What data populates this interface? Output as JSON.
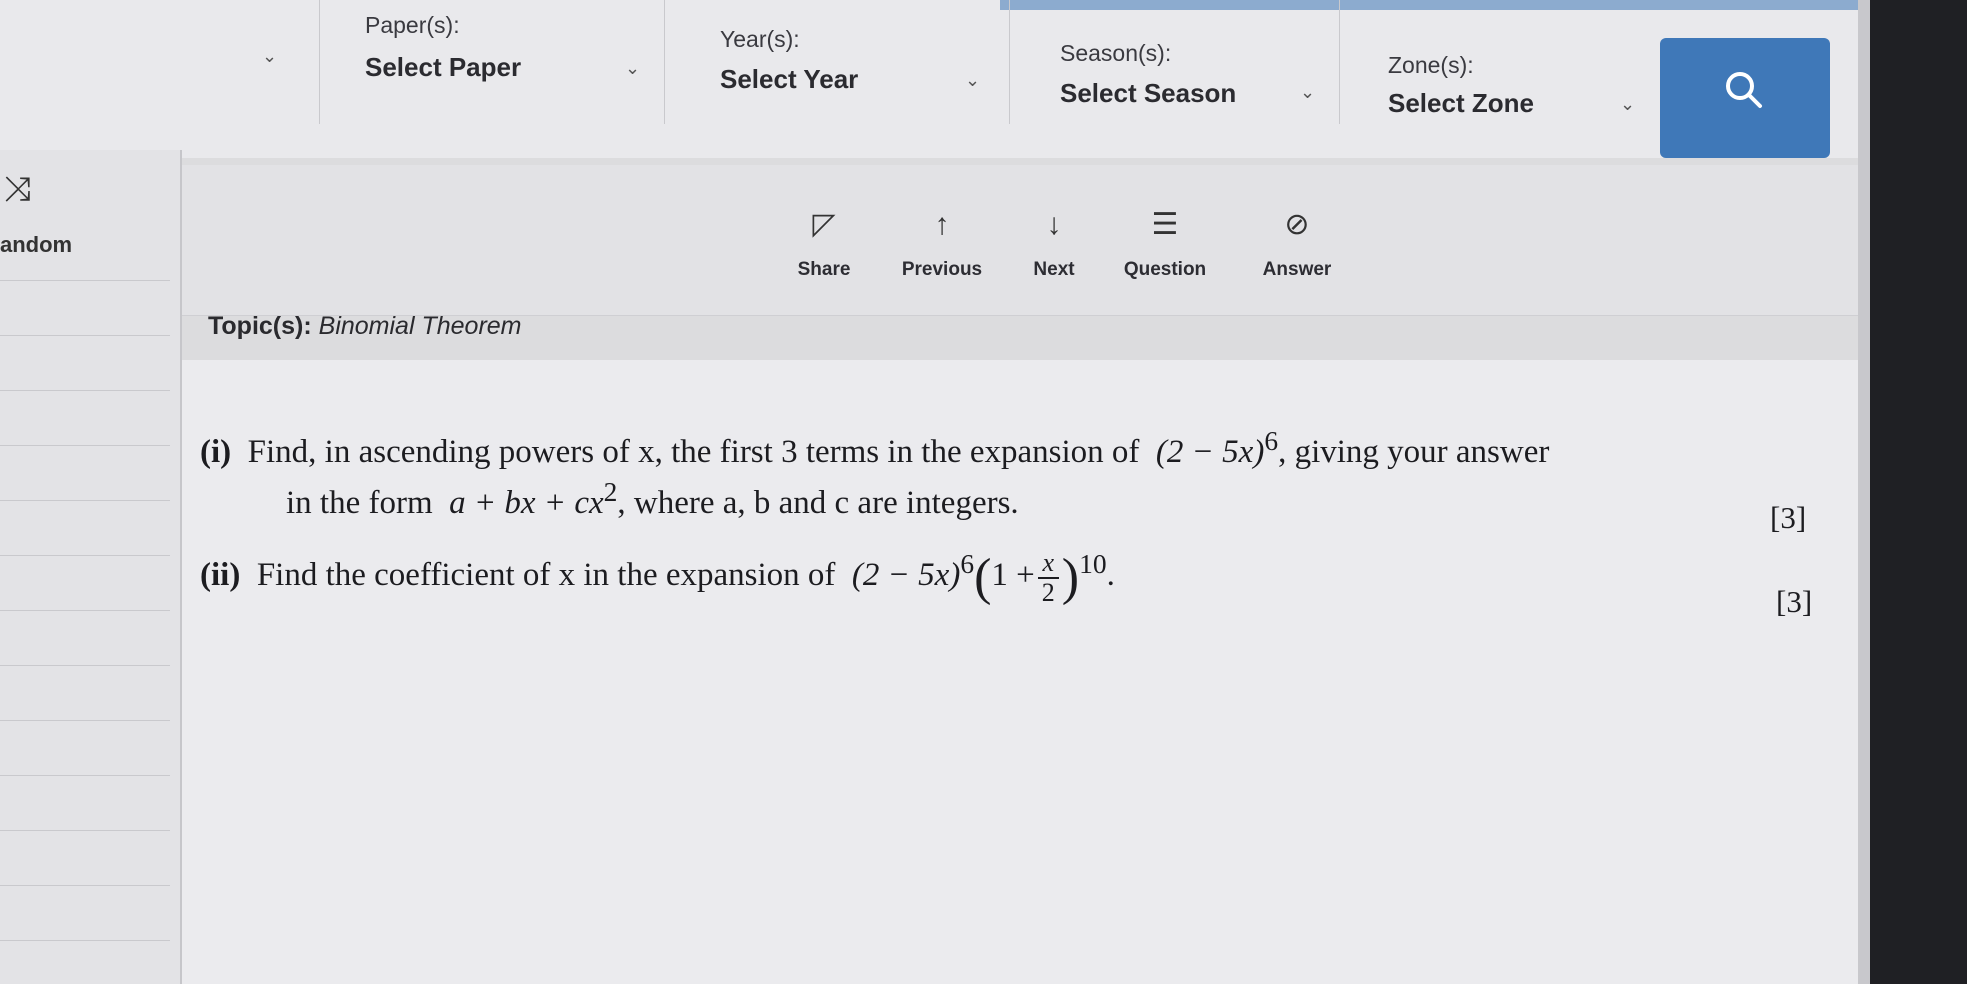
{
  "filters": [
    {
      "label": "Paper(s):",
      "value": "Select Paper"
    },
    {
      "label": "Year(s):",
      "value": "Select Year"
    },
    {
      "label": "Season(s):",
      "value": "Select Season"
    },
    {
      "label": "Zone(s):",
      "value": "Select Zone"
    }
  ],
  "search": {
    "icon": "search-icon"
  },
  "left_rail": {
    "random_label": "andom",
    "icon": "shuffle-icon"
  },
  "toolbar": [
    {
      "label": "Share",
      "icon": "share-icon"
    },
    {
      "label": "Previous",
      "icon": "arrow-up-icon"
    },
    {
      "label": "Next",
      "icon": "arrow-down-icon"
    },
    {
      "label": "Question",
      "icon": "list-icon"
    },
    {
      "label": "Answer",
      "icon": "link-icon"
    }
  ],
  "topic": {
    "prefix": "Topic(s):",
    "value": "Binomial Theorem"
  },
  "questions": [
    {
      "number": "(i)",
      "line1_text": "Find, in ascending powers of x, the first 3 terms in the expansion of",
      "line1_expr": "(2 − 5x)",
      "line1_power": "6",
      "line1_tail": ", giving your answer",
      "line2_lead": "in the form",
      "line2_expr": "a + bx + cx",
      "line2_power": "2",
      "line2_tail": ", where a, b and c are integers.",
      "marks": "[3]"
    },
    {
      "number": "(ii)",
      "text": "Find the coefficient of x in the expansion of",
      "expr_a": "(2 − 5x)",
      "expr_a_power": "6",
      "frac_num": "x",
      "frac_den": "2",
      "expr_b_lead": "1 +",
      "expr_b_power": "10",
      "marks": "[3]"
    }
  ],
  "colors": {
    "accent": "#3f78b8",
    "background": "#e9e9ec",
    "bezel": "#1f2024"
  }
}
